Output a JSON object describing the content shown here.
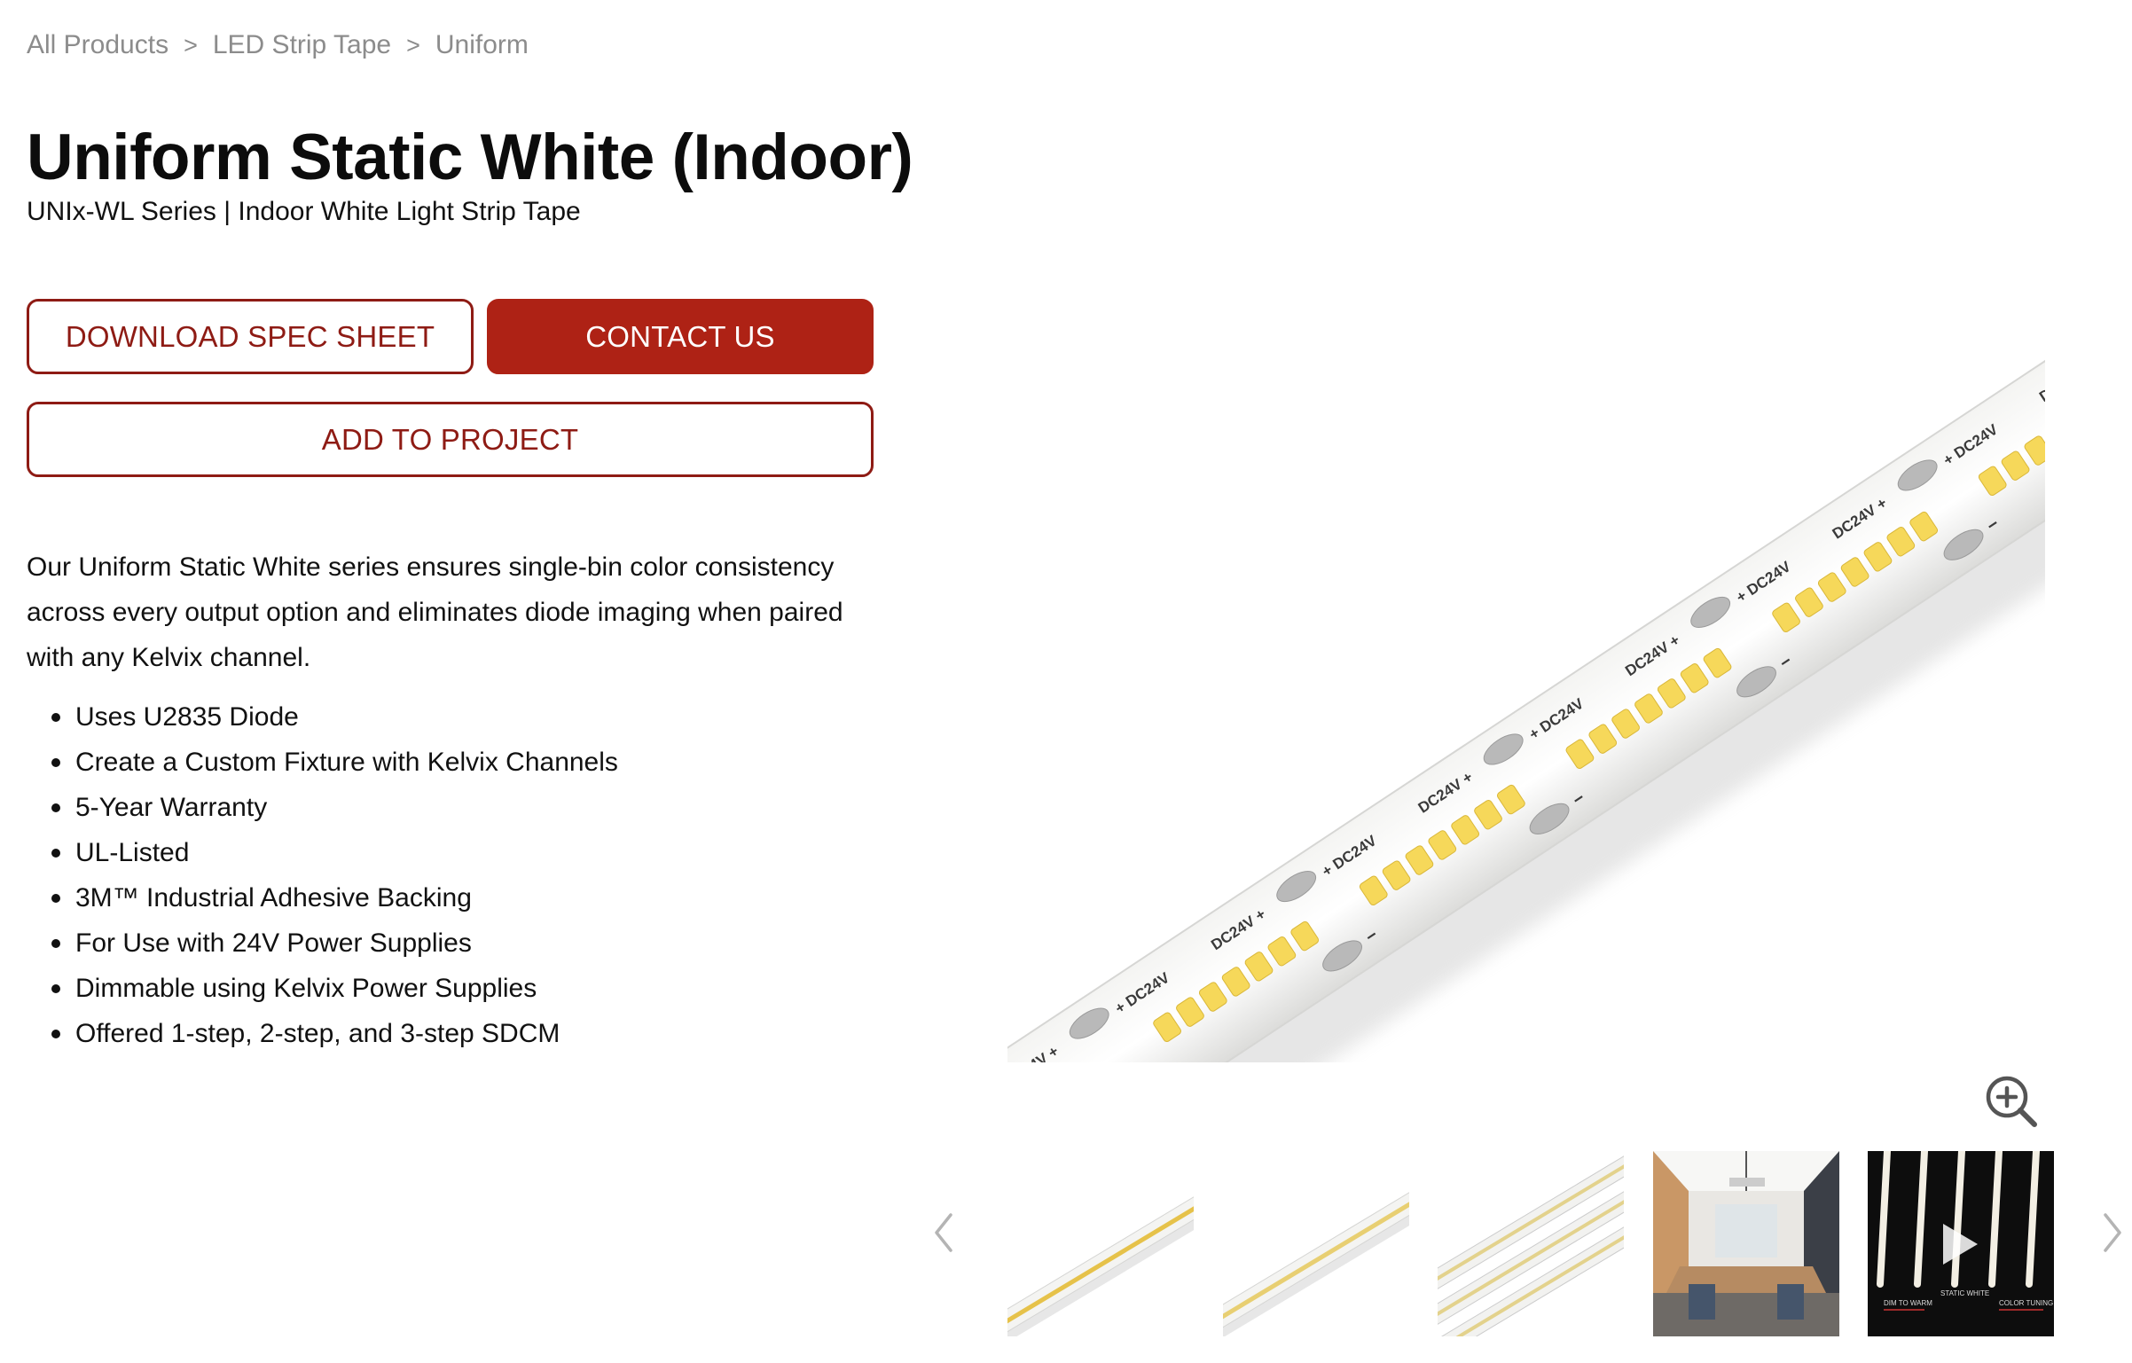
{
  "breadcrumb": {
    "items": [
      "All Products",
      "LED Strip Tape",
      "Uniform"
    ],
    "separator": ">"
  },
  "product": {
    "title": "Uniform Static White (Indoor)",
    "subtitle": "UNIx-WL Series | Indoor White Light Strip Tape",
    "description": "Our Uniform Static White series ensures single-bin color consistency across every output option and eliminates diode imaging when paired with any Kelvix channel.",
    "features": [
      "Uses U2835 Diode",
      "Create a Custom Fixture with Kelvix Channels",
      "5-Year Warranty",
      "UL-Listed",
      "3M™ Industrial Adhesive Backing",
      "For Use with 24V Power Supplies",
      "Dimmable using Kelvix Power Supplies",
      "Offered 1-step, 2-step, and 3-step SDCM"
    ]
  },
  "buttons": {
    "download": "DOWNLOAD SPEC SHEET",
    "contact": "CONTACT US",
    "project": "ADD TO PROJECT"
  },
  "gallery": {
    "strip_marking": "DC24V",
    "plus": "+",
    "minus": "−",
    "thumb5_labels": {
      "left": "DIM TO WARM",
      "center": "STATIC WHITE",
      "right": "COLOR TUNING"
    },
    "icons": {
      "zoom": "zoom-in-icon",
      "prev": "chevron-left-icon",
      "next": "chevron-right-icon",
      "play": "play-icon"
    }
  },
  "colors": {
    "accent": "#ae2215",
    "accent_dark": "#8e1b14",
    "breadcrumb": "#8c8c8c",
    "diode": "#f6d85a"
  }
}
